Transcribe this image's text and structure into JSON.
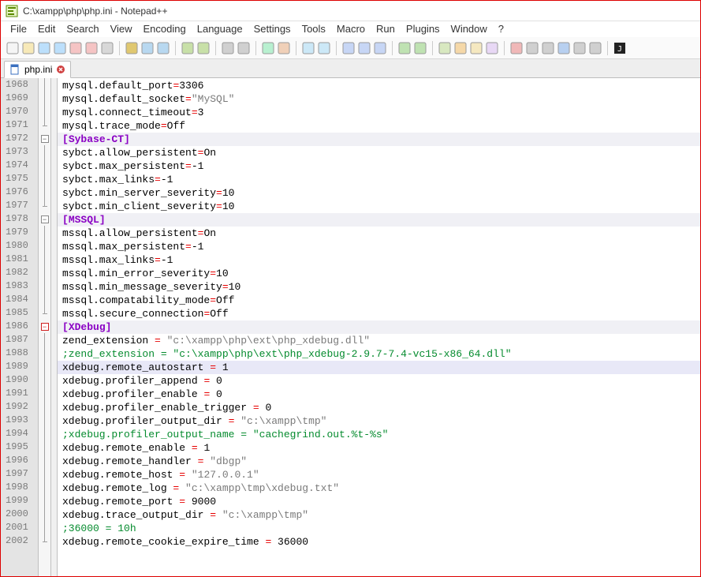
{
  "window": {
    "title": "C:\\xampp\\php\\php.ini - Notepad++"
  },
  "menu": [
    "File",
    "Edit",
    "Search",
    "View",
    "Encoding",
    "Language",
    "Settings",
    "Tools",
    "Macro",
    "Run",
    "Plugins",
    "Window",
    "?"
  ],
  "tab": {
    "label": "php.ini"
  },
  "lines": [
    {
      "n": 1968,
      "fold": "line",
      "cls": "",
      "seg": [
        [
          "mysql.default_port",
          "t"
        ],
        [
          "=",
          "op"
        ],
        [
          "3306",
          "t"
        ]
      ]
    },
    {
      "n": 1969,
      "fold": "line",
      "cls": "",
      "seg": [
        [
          "mysql.default_socket",
          "t"
        ],
        [
          "=",
          "op"
        ],
        [
          "\"MySQL\"",
          "str"
        ]
      ]
    },
    {
      "n": 1970,
      "fold": "line",
      "cls": "",
      "seg": [
        [
          "mysql.connect_timeout",
          "t"
        ],
        [
          "=",
          "op"
        ],
        [
          "3",
          "t"
        ]
      ]
    },
    {
      "n": 1971,
      "fold": "end",
      "cls": "",
      "seg": [
        [
          "mysql.trace_mode",
          "t"
        ],
        [
          "=",
          "op"
        ],
        [
          "Off",
          "t"
        ]
      ]
    },
    {
      "n": 1972,
      "fold": "box",
      "cls": "section-hdr",
      "seg": [
        [
          "[",
          "brk"
        ],
        [
          "Sybase-CT",
          "kw"
        ],
        [
          "]",
          "brk"
        ]
      ]
    },
    {
      "n": 1973,
      "fold": "line",
      "cls": "",
      "seg": [
        [
          "sybct.allow_persistent",
          "t"
        ],
        [
          "=",
          "op"
        ],
        [
          "On",
          "t"
        ]
      ]
    },
    {
      "n": 1974,
      "fold": "line",
      "cls": "",
      "seg": [
        [
          "sybct.max_persistent",
          "t"
        ],
        [
          "=",
          "op"
        ],
        [
          "-1",
          "t"
        ]
      ]
    },
    {
      "n": 1975,
      "fold": "line",
      "cls": "",
      "seg": [
        [
          "sybct.max_links",
          "t"
        ],
        [
          "=",
          "op"
        ],
        [
          "-1",
          "t"
        ]
      ]
    },
    {
      "n": 1976,
      "fold": "line",
      "cls": "",
      "seg": [
        [
          "sybct.min_server_severity",
          "t"
        ],
        [
          "=",
          "op"
        ],
        [
          "10",
          "t"
        ]
      ]
    },
    {
      "n": 1977,
      "fold": "end",
      "cls": "",
      "seg": [
        [
          "sybct.min_client_severity",
          "t"
        ],
        [
          "=",
          "op"
        ],
        [
          "10",
          "t"
        ]
      ]
    },
    {
      "n": 1978,
      "fold": "box",
      "cls": "section-hdr",
      "seg": [
        [
          "[",
          "brk"
        ],
        [
          "MSSQL",
          "kw"
        ],
        [
          "]",
          "brk"
        ]
      ]
    },
    {
      "n": 1979,
      "fold": "line",
      "cls": "",
      "seg": [
        [
          "mssql.allow_persistent",
          "t"
        ],
        [
          "=",
          "op"
        ],
        [
          "On",
          "t"
        ]
      ]
    },
    {
      "n": 1980,
      "fold": "line",
      "cls": "",
      "seg": [
        [
          "mssql.max_persistent",
          "t"
        ],
        [
          "=",
          "op"
        ],
        [
          "-1",
          "t"
        ]
      ]
    },
    {
      "n": 1981,
      "fold": "line",
      "cls": "",
      "seg": [
        [
          "mssql.max_links",
          "t"
        ],
        [
          "=",
          "op"
        ],
        [
          "-1",
          "t"
        ]
      ]
    },
    {
      "n": 1982,
      "fold": "line",
      "cls": "",
      "seg": [
        [
          "mssql.min_error_severity",
          "t"
        ],
        [
          "=",
          "op"
        ],
        [
          "10",
          "t"
        ]
      ]
    },
    {
      "n": 1983,
      "fold": "line",
      "cls": "",
      "seg": [
        [
          "mssql.min_message_severity",
          "t"
        ],
        [
          "=",
          "op"
        ],
        [
          "10",
          "t"
        ]
      ]
    },
    {
      "n": 1984,
      "fold": "line",
      "cls": "",
      "seg": [
        [
          "mssql.compatability_mode",
          "t"
        ],
        [
          "=",
          "op"
        ],
        [
          "Off",
          "t"
        ]
      ]
    },
    {
      "n": 1985,
      "fold": "end",
      "cls": "",
      "seg": [
        [
          "mssql.secure_connection",
          "t"
        ],
        [
          "=",
          "op"
        ],
        [
          "Off",
          "t"
        ]
      ]
    },
    {
      "n": 1986,
      "fold": "box-red",
      "cls": "section-hdr",
      "seg": [
        [
          "[",
          "brk"
        ],
        [
          "XDebug",
          "kw"
        ],
        [
          "]",
          "brk"
        ]
      ]
    },
    {
      "n": 1987,
      "fold": "line",
      "cls": "",
      "seg": [
        [
          "zend_extension",
          "t"
        ],
        [
          " = ",
          "op"
        ],
        [
          "\"c:\\xampp\\php\\ext\\php_xdebug.dll\"",
          "str"
        ]
      ]
    },
    {
      "n": 1988,
      "fold": "line",
      "cls": "",
      "seg": [
        [
          ";zend_extension = \"c:\\xampp\\php\\ext\\php_xdebug-2.9.7-7.4-vc15-x86_64.dll\"",
          "com"
        ]
      ]
    },
    {
      "n": 1989,
      "fold": "line",
      "cls": "hl",
      "seg": [
        [
          "xdebug.remote_autostart",
          "t"
        ],
        [
          " = ",
          "op"
        ],
        [
          "1",
          "t"
        ]
      ]
    },
    {
      "n": 1990,
      "fold": "line",
      "cls": "",
      "seg": [
        [
          "xdebug.profiler_append",
          "t"
        ],
        [
          " = ",
          "op"
        ],
        [
          "0",
          "t"
        ]
      ]
    },
    {
      "n": 1991,
      "fold": "line",
      "cls": "",
      "seg": [
        [
          "xdebug.profiler_enable",
          "t"
        ],
        [
          " = ",
          "op"
        ],
        [
          "0",
          "t"
        ]
      ]
    },
    {
      "n": 1992,
      "fold": "line",
      "cls": "",
      "seg": [
        [
          "xdebug.profiler_enable_trigger",
          "t"
        ],
        [
          " = ",
          "op"
        ],
        [
          "0",
          "t"
        ]
      ]
    },
    {
      "n": 1993,
      "fold": "line",
      "cls": "",
      "seg": [
        [
          "xdebug.profiler_output_dir",
          "t"
        ],
        [
          " = ",
          "op"
        ],
        [
          "\"c:\\xampp\\tmp\"",
          "str"
        ]
      ]
    },
    {
      "n": 1994,
      "fold": "line",
      "cls": "",
      "seg": [
        [
          ";xdebug.profiler_output_name = \"cachegrind.out.%t-%s\"",
          "com"
        ]
      ]
    },
    {
      "n": 1995,
      "fold": "line",
      "cls": "",
      "seg": [
        [
          "xdebug.remote_enable",
          "t"
        ],
        [
          " = ",
          "op"
        ],
        [
          "1",
          "t"
        ]
      ]
    },
    {
      "n": 1996,
      "fold": "line",
      "cls": "",
      "seg": [
        [
          "xdebug.remote_handler",
          "t"
        ],
        [
          " = ",
          "op"
        ],
        [
          "\"dbgp\"",
          "str"
        ]
      ]
    },
    {
      "n": 1997,
      "fold": "line",
      "cls": "",
      "seg": [
        [
          "xdebug.remote_host",
          "t"
        ],
        [
          " = ",
          "op"
        ],
        [
          "\"127.0.0.1\"",
          "str"
        ]
      ]
    },
    {
      "n": 1998,
      "fold": "line",
      "cls": "",
      "seg": [
        [
          "xdebug.remote_log",
          "t"
        ],
        [
          " = ",
          "op"
        ],
        [
          "\"c:\\xampp\\tmp\\xdebug.txt\"",
          "str"
        ]
      ]
    },
    {
      "n": 1999,
      "fold": "line",
      "cls": "",
      "seg": [
        [
          "xdebug.remote_port",
          "t"
        ],
        [
          " = ",
          "op"
        ],
        [
          "9000",
          "t"
        ]
      ]
    },
    {
      "n": 2000,
      "fold": "line",
      "cls": "",
      "seg": [
        [
          "xdebug.trace_output_dir",
          "t"
        ],
        [
          " = ",
          "op"
        ],
        [
          "\"c:\\xampp\\tmp\"",
          "str"
        ]
      ]
    },
    {
      "n": 2001,
      "fold": "line",
      "cls": "",
      "seg": [
        [
          ";36000 = 10h",
          "com"
        ]
      ]
    },
    {
      "n": 2002,
      "fold": "end",
      "cls": "",
      "seg": [
        [
          "xdebug.remote_cookie_expire_time",
          "t"
        ],
        [
          " = ",
          "op"
        ],
        [
          "36000",
          "t"
        ]
      ]
    }
  ],
  "toolbar_icons": [
    "new",
    "open",
    "save",
    "save-all",
    "close",
    "close-all",
    "print",
    "cut",
    "copy",
    "paste",
    "undo",
    "redo",
    "find",
    "replace",
    "zoom-in",
    "zoom-out",
    "sync",
    "wrap",
    "wrap2",
    "show-all",
    "indent",
    "outdent",
    "pilcrow",
    "doc",
    "folder",
    "eye",
    "rec",
    "stop",
    "play",
    "play2",
    "ff",
    "list",
    "list2",
    "j"
  ]
}
